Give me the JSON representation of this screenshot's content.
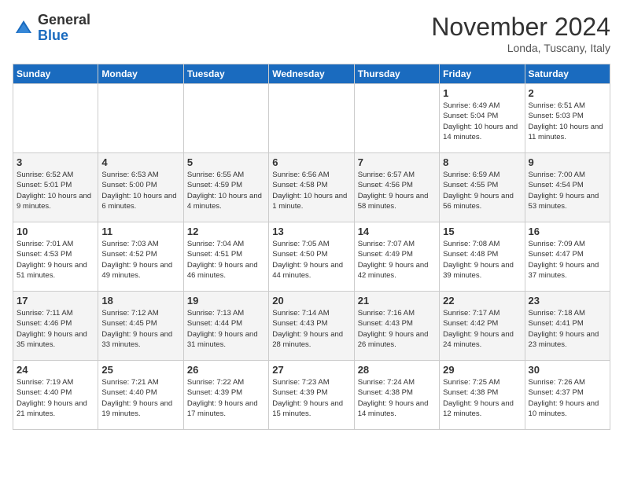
{
  "header": {
    "logo_general": "General",
    "logo_blue": "Blue",
    "month_title": "November 2024",
    "location": "Londa, Tuscany, Italy"
  },
  "days_of_week": [
    "Sunday",
    "Monday",
    "Tuesday",
    "Wednesday",
    "Thursday",
    "Friday",
    "Saturday"
  ],
  "weeks": [
    [
      {
        "day": "",
        "info": ""
      },
      {
        "day": "",
        "info": ""
      },
      {
        "day": "",
        "info": ""
      },
      {
        "day": "",
        "info": ""
      },
      {
        "day": "",
        "info": ""
      },
      {
        "day": "1",
        "info": "Sunrise: 6:49 AM\nSunset: 5:04 PM\nDaylight: 10 hours and 14 minutes."
      },
      {
        "day": "2",
        "info": "Sunrise: 6:51 AM\nSunset: 5:03 PM\nDaylight: 10 hours and 11 minutes."
      }
    ],
    [
      {
        "day": "3",
        "info": "Sunrise: 6:52 AM\nSunset: 5:01 PM\nDaylight: 10 hours and 9 minutes."
      },
      {
        "day": "4",
        "info": "Sunrise: 6:53 AM\nSunset: 5:00 PM\nDaylight: 10 hours and 6 minutes."
      },
      {
        "day": "5",
        "info": "Sunrise: 6:55 AM\nSunset: 4:59 PM\nDaylight: 10 hours and 4 minutes."
      },
      {
        "day": "6",
        "info": "Sunrise: 6:56 AM\nSunset: 4:58 PM\nDaylight: 10 hours and 1 minute."
      },
      {
        "day": "7",
        "info": "Sunrise: 6:57 AM\nSunset: 4:56 PM\nDaylight: 9 hours and 58 minutes."
      },
      {
        "day": "8",
        "info": "Sunrise: 6:59 AM\nSunset: 4:55 PM\nDaylight: 9 hours and 56 minutes."
      },
      {
        "day": "9",
        "info": "Sunrise: 7:00 AM\nSunset: 4:54 PM\nDaylight: 9 hours and 53 minutes."
      }
    ],
    [
      {
        "day": "10",
        "info": "Sunrise: 7:01 AM\nSunset: 4:53 PM\nDaylight: 9 hours and 51 minutes."
      },
      {
        "day": "11",
        "info": "Sunrise: 7:03 AM\nSunset: 4:52 PM\nDaylight: 9 hours and 49 minutes."
      },
      {
        "day": "12",
        "info": "Sunrise: 7:04 AM\nSunset: 4:51 PM\nDaylight: 9 hours and 46 minutes."
      },
      {
        "day": "13",
        "info": "Sunrise: 7:05 AM\nSunset: 4:50 PM\nDaylight: 9 hours and 44 minutes."
      },
      {
        "day": "14",
        "info": "Sunrise: 7:07 AM\nSunset: 4:49 PM\nDaylight: 9 hours and 42 minutes."
      },
      {
        "day": "15",
        "info": "Sunrise: 7:08 AM\nSunset: 4:48 PM\nDaylight: 9 hours and 39 minutes."
      },
      {
        "day": "16",
        "info": "Sunrise: 7:09 AM\nSunset: 4:47 PM\nDaylight: 9 hours and 37 minutes."
      }
    ],
    [
      {
        "day": "17",
        "info": "Sunrise: 7:11 AM\nSunset: 4:46 PM\nDaylight: 9 hours and 35 minutes."
      },
      {
        "day": "18",
        "info": "Sunrise: 7:12 AM\nSunset: 4:45 PM\nDaylight: 9 hours and 33 minutes."
      },
      {
        "day": "19",
        "info": "Sunrise: 7:13 AM\nSunset: 4:44 PM\nDaylight: 9 hours and 31 minutes."
      },
      {
        "day": "20",
        "info": "Sunrise: 7:14 AM\nSunset: 4:43 PM\nDaylight: 9 hours and 28 minutes."
      },
      {
        "day": "21",
        "info": "Sunrise: 7:16 AM\nSunset: 4:43 PM\nDaylight: 9 hours and 26 minutes."
      },
      {
        "day": "22",
        "info": "Sunrise: 7:17 AM\nSunset: 4:42 PM\nDaylight: 9 hours and 24 minutes."
      },
      {
        "day": "23",
        "info": "Sunrise: 7:18 AM\nSunset: 4:41 PM\nDaylight: 9 hours and 23 minutes."
      }
    ],
    [
      {
        "day": "24",
        "info": "Sunrise: 7:19 AM\nSunset: 4:40 PM\nDaylight: 9 hours and 21 minutes."
      },
      {
        "day": "25",
        "info": "Sunrise: 7:21 AM\nSunset: 4:40 PM\nDaylight: 9 hours and 19 minutes."
      },
      {
        "day": "26",
        "info": "Sunrise: 7:22 AM\nSunset: 4:39 PM\nDaylight: 9 hours and 17 minutes."
      },
      {
        "day": "27",
        "info": "Sunrise: 7:23 AM\nSunset: 4:39 PM\nDaylight: 9 hours and 15 minutes."
      },
      {
        "day": "28",
        "info": "Sunrise: 7:24 AM\nSunset: 4:38 PM\nDaylight: 9 hours and 14 minutes."
      },
      {
        "day": "29",
        "info": "Sunrise: 7:25 AM\nSunset: 4:38 PM\nDaylight: 9 hours and 12 minutes."
      },
      {
        "day": "30",
        "info": "Sunrise: 7:26 AM\nSunset: 4:37 PM\nDaylight: 9 hours and 10 minutes."
      }
    ]
  ]
}
